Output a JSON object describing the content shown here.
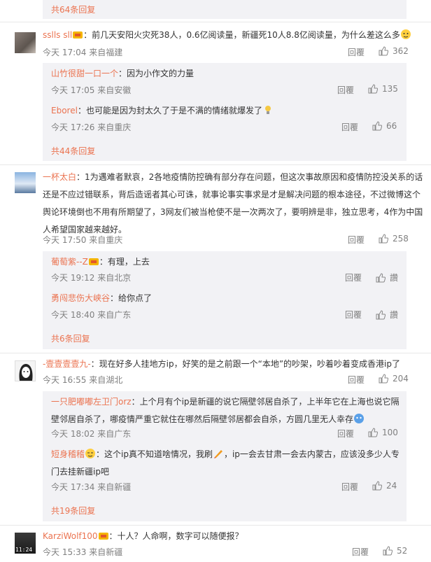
{
  "reply_label": "回覆",
  "comments": [
    {
      "more": "共64条回复"
    },
    {
      "user": "sslls sll",
      "text": "：前几天安阳火灾死38人，0.6亿阅读量，新疆死10人8.8亿阅读量，为什么差这么多",
      "time": "今天 17:04 来自福建",
      "likes": "362",
      "replies": [
        {
          "user": "山竹很甜一口一个",
          "text": "：因为小作文的力量",
          "time": "今天 17:05 来自安徽",
          "likes": "135"
        },
        {
          "user": "Eborel",
          "text": "：也可能是因为封太久了于是不满的情绪就爆发了",
          "time": "今天 17:26 来自重庆",
          "likes": "66"
        }
      ],
      "more": "共44条回复"
    },
    {
      "user": "一杯太白",
      "text": "：1为遇难者默哀，2各地疫情防控确有部分存在问题，但这次事故原因和疫情防控没关系的话还是不应过错联系，背后造谣者其心可诛，就事论事实事求是才是解决问题的根本途径，不过微博这个舆论环境倒也不用有所期望了，3网友们被当枪使不是一次两次了，要明辨是非，独立思考，4作为中国人希望国家越来越好。",
      "time": "今天 17:50 来自重庆",
      "likes": "258",
      "replies": [
        {
          "user": "葡萄紫--Z",
          "text": "：有理，上去",
          "time": "今天 19:12 来自北京",
          "likes": "讚"
        },
        {
          "user": "勇闯悲伤大峡谷",
          "text": "：给你点了",
          "time": "今天 18:40 来自广东",
          "likes": "讚"
        }
      ],
      "more": "共6条回复"
    },
    {
      "user": "-壹壹壹壹九-",
      "text": "：现在好多人挂地方ip，好笑的是之前跟一个“本地”的吵架，吵着吵着变成香港ip了",
      "time": "今天 16:55 来自湖北",
      "likes": "204",
      "replies": [
        {
          "user": "一只肥嘟嘟左卫门orz",
          "text": "：上个月有个ip是新疆的说它隔壁邻居自杀了，上半年它在上海也说它隔壁邻居自杀了，哪疫情严重它就住在哪然后隔壁邻居都会自杀，方圆几里无人幸存",
          "time": "今天 18:02 来自广东",
          "likes": "100"
        },
        {
          "user": "短身稽稽",
          "text": "：这个ip真不知道啥情况，我刷",
          "text2": "，ip一会去甘肃一会去内蒙古，应该没多少人专门去挂新疆ip吧",
          "time": "今天 17:34 来自新疆",
          "likes": "24"
        }
      ],
      "more": "共19条回复"
    },
    {
      "user": "KarziWolf100",
      "text": "：十人？人命啊，数字可以随便报？",
      "time": "今天 15:33 来自新疆",
      "likes": "52",
      "avatar_text": "11:24"
    }
  ],
  "colors": {
    "username": "#eb7350",
    "meta": "#808080",
    "reply_bg": "#f2f2f5"
  },
  "icons": [
    "thumb-up-icon",
    "vip-badge-icon",
    "emoji-icon"
  ]
}
